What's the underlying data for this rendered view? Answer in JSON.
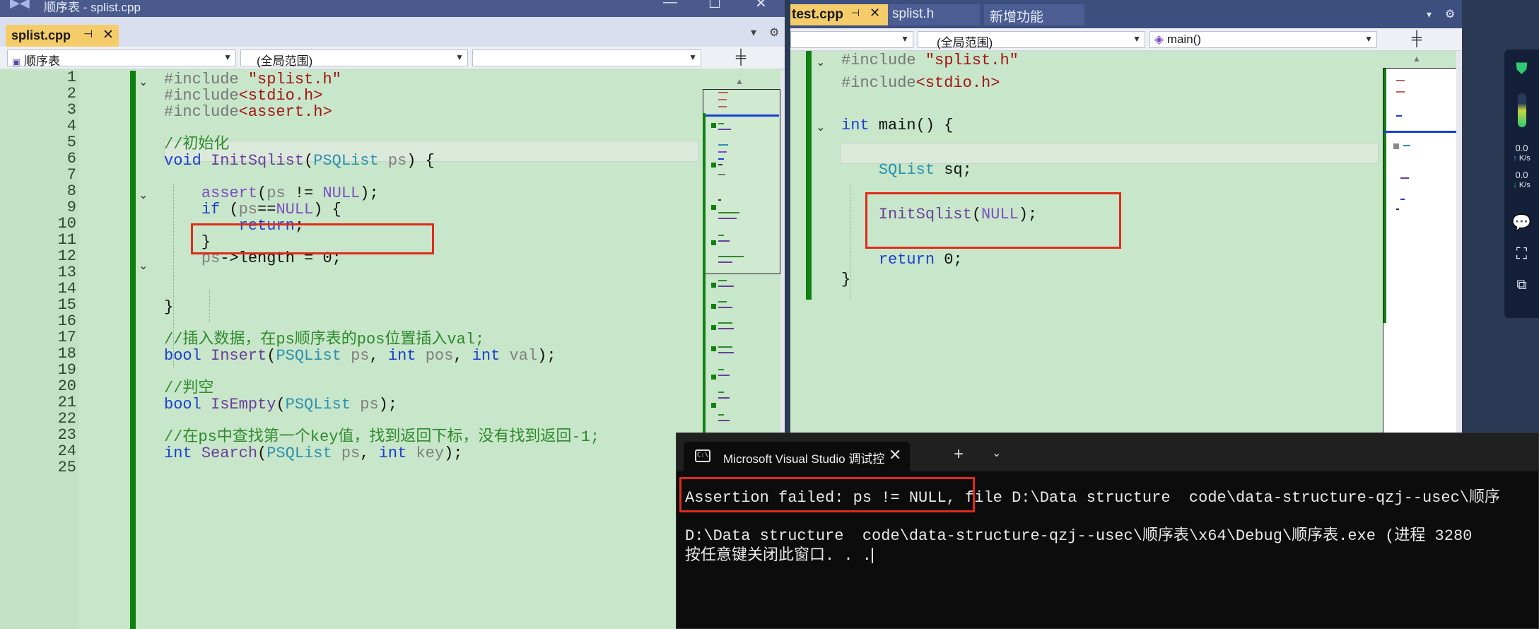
{
  "left_window": {
    "title": "顺序表 - splist.cpp",
    "window_controls": [
      "—",
      "☐",
      "✕"
    ],
    "tab": {
      "label": "splist.cpp",
      "pin": "⊣",
      "close": "✕"
    },
    "nav": {
      "project": "顺序表",
      "scope": "(全局范围)",
      "member": ""
    },
    "lines": [
      {
        "num": "1",
        "html": "<span class='pp'>#include</span> <span class='str'>\"splist.h\"</span>"
      },
      {
        "num": "2",
        "html": "<span class='pp'>#include</span><span class='inc'>&lt;stdio.h&gt;</span>"
      },
      {
        "num": "3",
        "html": "<span class='pp'>#include</span><span class='inc'>&lt;assert.h&gt;</span>"
      },
      {
        "num": "4",
        "html": ""
      },
      {
        "num": "5",
        "html": "<span class='cmt'>//初始化</span>"
      },
      {
        "num": "6",
        "html": "<span class='kw'>void</span> <span class='fn'>InitSqlist</span>(<span class='typ'>PSQList</span> <span class='par'>ps</span>) {"
      },
      {
        "num": "7",
        "html": ""
      },
      {
        "num": "8",
        "html": "    <span class='mac'>assert</span>(<span class='par'>ps</span> != <span class='mac'>NULL</span>);"
      },
      {
        "num": "9",
        "html": "    <span class='kw'>if</span> (<span class='par'>ps</span>==<span class='mac'>NULL</span>) {"
      },
      {
        "num": "10",
        "html": "        <span class='kw'>return</span>;"
      },
      {
        "num": "11",
        "html": "    }"
      },
      {
        "num": "12",
        "html": "    <span class='par'>ps</span>-&gt;length = 0;"
      },
      {
        "num": "13",
        "html": ""
      },
      {
        "num": "14",
        "html": ""
      },
      {
        "num": "15",
        "html": "}"
      },
      {
        "num": "16",
        "html": ""
      },
      {
        "num": "17",
        "html": "<span class='cmt'>//插入数据，在ps顺序表的pos位置插入val;</span>"
      },
      {
        "num": "18",
        "html": "<span class='kw'>bool</span> <span class='fn'>Insert</span>(<span class='typ'>PSQList</span> <span class='par'>ps</span>, <span class='kw'>int</span> <span class='par'>pos</span>, <span class='kw'>int</span> <span class='par'>val</span>);"
      },
      {
        "num": "19",
        "html": ""
      },
      {
        "num": "20",
        "html": "<span class='cmt'>//判空</span>"
      },
      {
        "num": "21",
        "html": "<span class='kw'>bool</span> <span class='fn'>IsEmpty</span>(<span class='typ'>PSQList</span> <span class='par'>ps</span>);"
      },
      {
        "num": "22",
        "html": ""
      },
      {
        "num": "23",
        "html": "<span class='cmt'>//在ps中查找第一个key值，找到返回下标，没有找到返回-1;</span>"
      },
      {
        "num": "24",
        "html": "<span class='kw'>int</span> <span class='fn'>Search</span>(<span class='typ'>PSQList</span> <span class='par'>ps</span>, <span class='kw'>int</span> <span class='par'>key</span>);"
      },
      {
        "num": "25",
        "html": ""
      }
    ]
  },
  "right_window": {
    "tabs": [
      {
        "label": "test.cpp",
        "pin": "⊣",
        "close": "✕"
      },
      {
        "label": "splist.h"
      },
      {
        "label": "新增功能"
      }
    ],
    "nav": {
      "project": "",
      "scope": "(全局范围)",
      "member": "main()"
    },
    "lines": [
      {
        "html": "<span class='pp'>#include</span> <span class='str'>\"splist.h\"</span>"
      },
      {
        "html": "<span class='pp'>#include</span><span class='inc'>&lt;stdio.h&gt;</span>"
      },
      {
        "html": ""
      },
      {
        "html": "<span class='kw'>int</span> main() {"
      },
      {
        "html": ""
      },
      {
        "html": "    <span class='typ'>SQList</span> sq;"
      },
      {
        "html": ""
      },
      {
        "html": "    <span class='fn'>InitSqlist</span>(<span class='mac'>NULL</span>);"
      },
      {
        "html": ""
      },
      {
        "html": "    <span class='kw'>return</span> 0;"
      },
      {
        "html": "}"
      }
    ]
  },
  "console": {
    "tab_title": "Microsoft Visual Studio 调试控",
    "close": "✕",
    "add": "+",
    "dropdown": "⌄",
    "assertion_msg": "Assertion failed: ps != NULL,",
    "assertion_rest": " file D:\\Data structure  code\\data-structure-qzj--usec\\顺序",
    "exit_line": "D:\\Data structure  code\\data-structure-qzj--usec\\顺序表\\x64\\Debug\\顺序表.exe (进程 3280",
    "press_key": "按任意键关闭此窗口. . ."
  },
  "side_panel": {
    "upload": "0.0",
    "upload_unit": "K/s",
    "download": "0.0",
    "download_unit": "K/s"
  },
  "colors": {
    "editor_bg": "#c8e6c9",
    "active_tab": "#f5cc6a",
    "highlight_box": "#e02a1a",
    "change_bar": "#108010"
  }
}
